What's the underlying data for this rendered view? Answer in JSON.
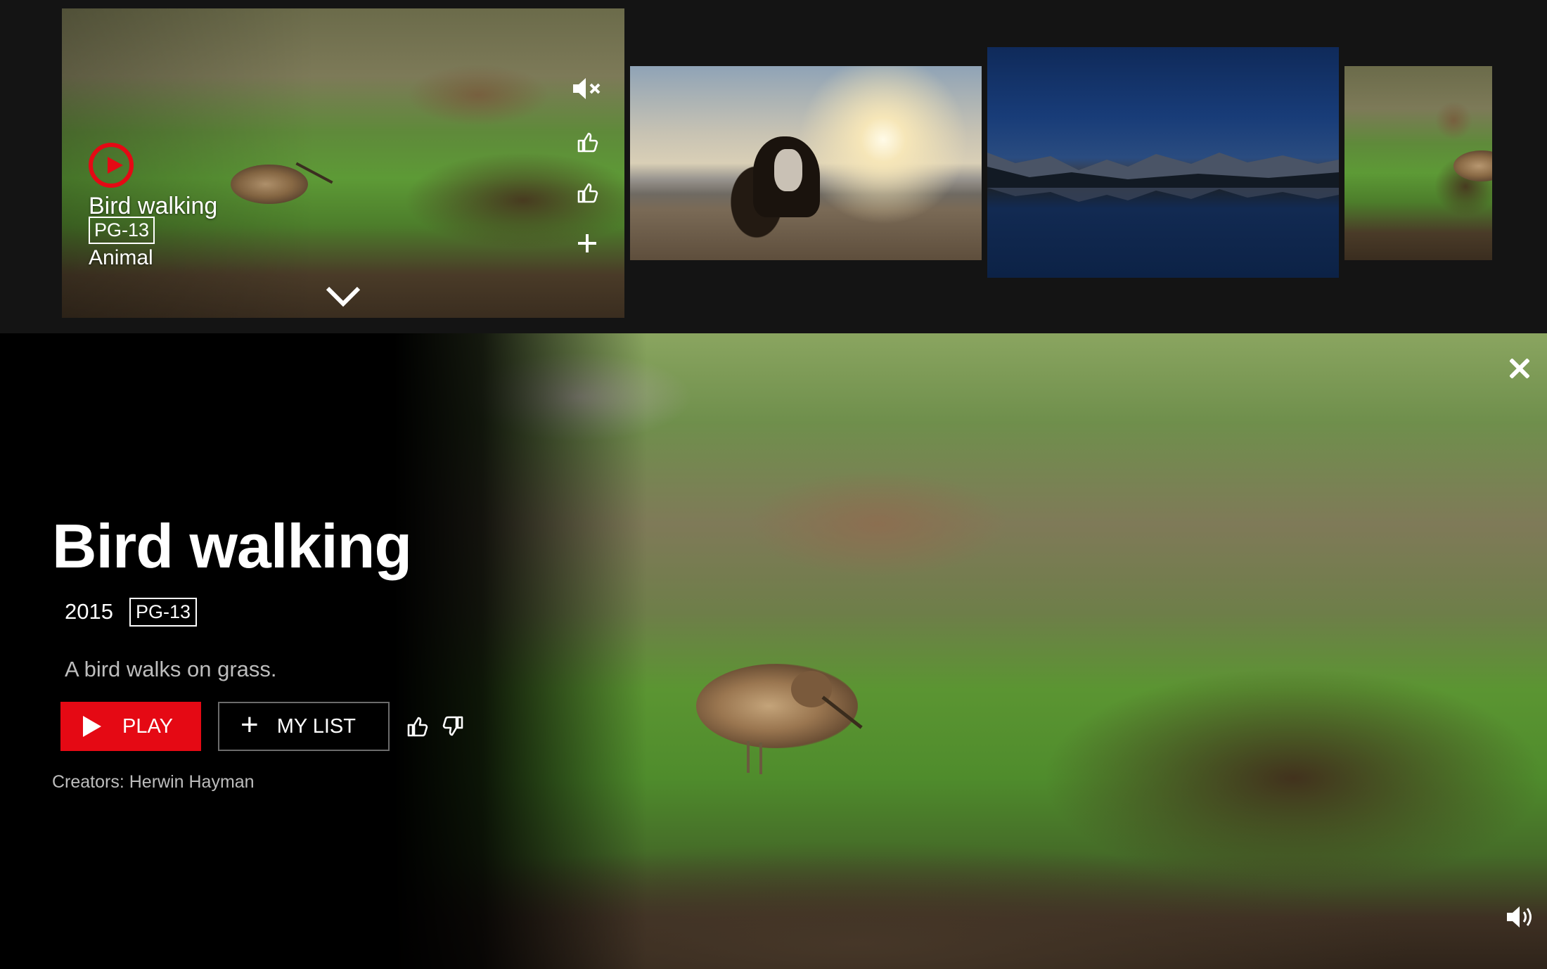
{
  "row": {
    "active_card": {
      "title": "Bird walking",
      "rating": "PG-13",
      "genre": "Animal",
      "icons": [
        "mute-icon",
        "thumbs-up-icon",
        "thumbs-up-icon",
        "plus-icon",
        "chevron-down-icon"
      ]
    },
    "cards": [
      {
        "scene": "puppy on beach at sunset"
      },
      {
        "scene": "mountain lake at night"
      },
      {
        "scene": "bird in grass"
      }
    ]
  },
  "detail": {
    "title": "Bird walking",
    "year": "2015",
    "rating": "PG-13",
    "synopsis": "A bird walks on grass.",
    "play_label": "PLAY",
    "mylist_label": "MY LIST",
    "creators": "Creators: Herwin Hayman"
  },
  "colors": {
    "accent": "#e50914",
    "background": "#141414",
    "panel": "#000000"
  }
}
